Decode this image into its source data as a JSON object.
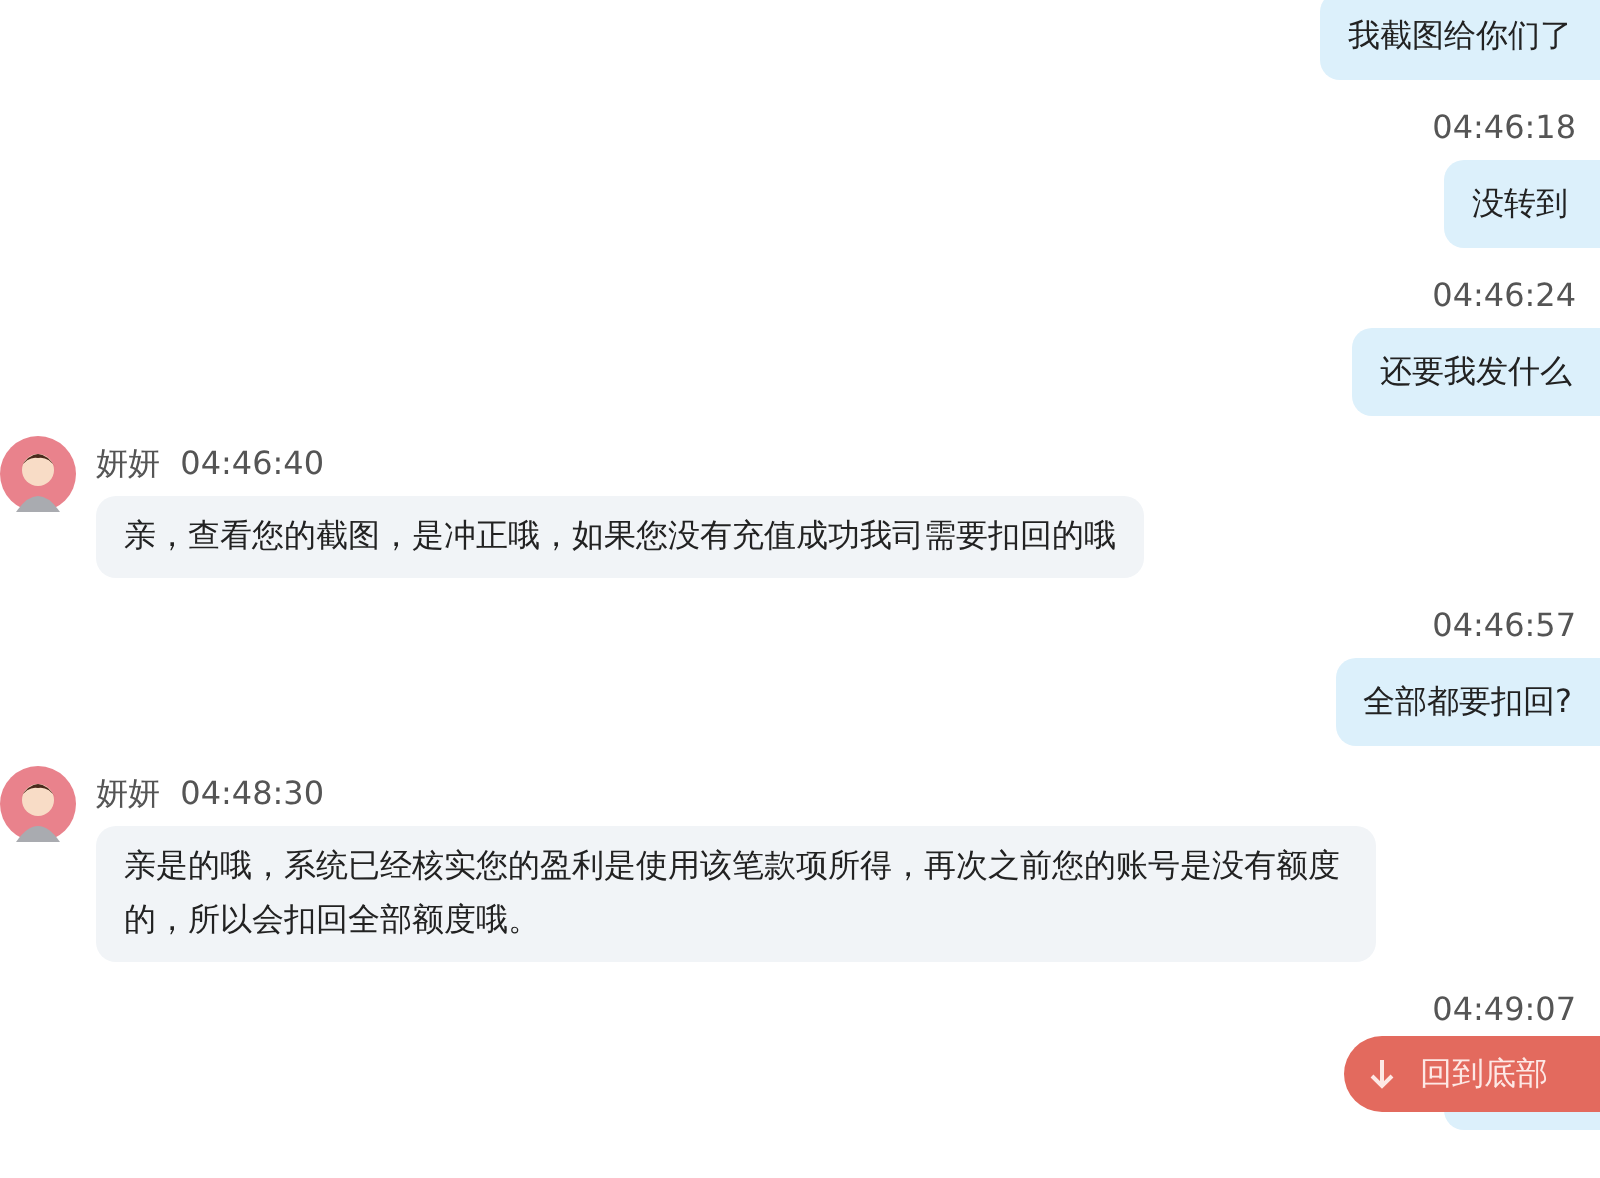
{
  "messages": [
    {
      "kind": "sent",
      "text": "我截图给你们了"
    },
    {
      "kind": "sent",
      "time": "04:46:18",
      "text": "没转到"
    },
    {
      "kind": "sent",
      "time": "04:46:24",
      "text": "还要我发什么"
    },
    {
      "kind": "received",
      "name": "妍妍",
      "time": "04:46:40",
      "text": "亲，查看您的截图，是冲正哦，如果您没有充值成功我司需要扣回的哦"
    },
    {
      "kind": "sent",
      "time": "04:46:57",
      "text": "全部都要扣回?"
    },
    {
      "kind": "received",
      "name": "妍妍",
      "time": "04:48:30",
      "text": "亲是的哦，系统已经核实您的盈利是使用该笔款项所得，再次之前您的账号是没有额度的，所以会扣回全部额度哦。"
    },
    {
      "kind": "sent",
      "time": "04:49:07"
    }
  ],
  "scroll_button": {
    "label": "回到底部"
  }
}
